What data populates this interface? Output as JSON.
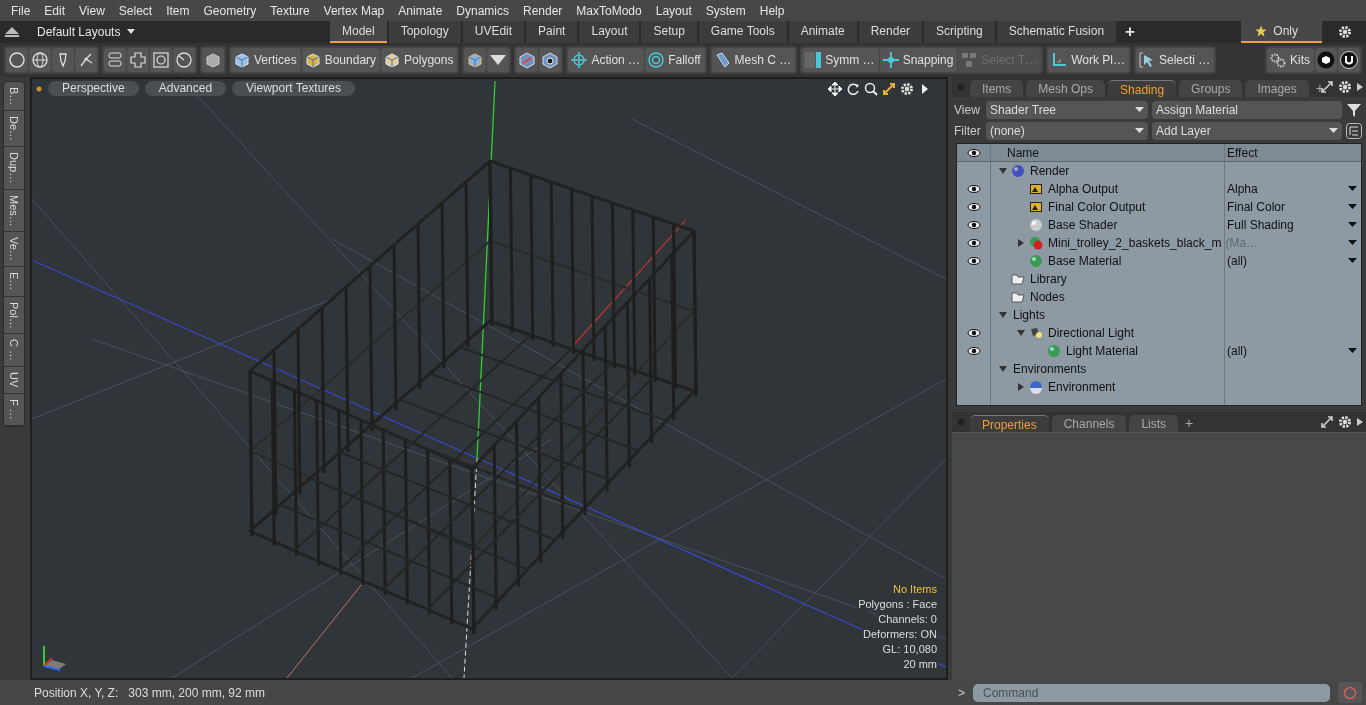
{
  "menu": [
    "File",
    "Edit",
    "View",
    "Select",
    "Item",
    "Geometry",
    "Texture",
    "Vertex Map",
    "Animate",
    "Dynamics",
    "Render",
    "MaxToModo",
    "Layout",
    "System",
    "Help"
  ],
  "layout_bar": {
    "layouts": "Default Layouts",
    "tabs": [
      {
        "label": "Model",
        "selected": true
      },
      {
        "label": "Topology",
        "selected": false
      },
      {
        "label": "UVEdit",
        "selected": false
      },
      {
        "label": "Paint",
        "selected": false
      },
      {
        "label": "Layout",
        "selected": false
      },
      {
        "label": "Setup",
        "selected": false
      },
      {
        "label": "Game Tools",
        "selected": false
      },
      {
        "label": "Animate",
        "selected": false
      },
      {
        "label": "Render",
        "selected": false
      },
      {
        "label": "Scripting",
        "selected": false
      },
      {
        "label": "Schematic Fusion",
        "selected": false
      }
    ],
    "add_tab": "+",
    "only": {
      "label": "Only",
      "selected": true
    }
  },
  "toolbar": [
    [
      {
        "kind": "icon"
      },
      {
        "kind": "icon"
      },
      {
        "kind": "icon"
      },
      {
        "kind": "icon"
      }
    ],
    [
      {
        "kind": "icon"
      },
      {
        "kind": "icon"
      },
      {
        "kind": "icon"
      },
      {
        "kind": "icon"
      }
    ],
    [
      {
        "kind": "icon"
      }
    ],
    [
      {
        "kind": "label",
        "label": "Vertices",
        "disabled": false
      },
      {
        "kind": "label",
        "label": "Boundary",
        "disabled": false
      },
      {
        "kind": "label",
        "label": "Polygons",
        "disabled": false
      }
    ],
    [
      {
        "kind": "icon"
      },
      {
        "kind": "icon"
      }
    ],
    [
      {
        "kind": "icon"
      },
      {
        "kind": "icon"
      }
    ],
    [
      {
        "kind": "label",
        "label": "Action …",
        "disabled": false
      },
      {
        "kind": "label",
        "label": "Falloff",
        "disabled": false
      }
    ],
    [
      {
        "kind": "label",
        "label": "Mesh C …",
        "disabled": false
      }
    ],
    [
      {
        "kind": "label",
        "label": "Symm …",
        "disabled": false
      },
      {
        "kind": "label",
        "label": "Snapping",
        "disabled": false
      },
      {
        "kind": "label",
        "label": "Select T…",
        "disabled": true
      }
    ],
    [
      {
        "kind": "label",
        "label": "Work Pl…",
        "disabled": false
      }
    ],
    [
      {
        "kind": "label",
        "label": "Selecti …",
        "disabled": false
      }
    ],
    [
      {
        "kind": "label",
        "label": "Kits",
        "disabled": false
      },
      {
        "kind": "icon"
      },
      {
        "kind": "icon"
      }
    ]
  ],
  "side_tabs": [
    "B…",
    "De…",
    "Dup…",
    "Mes…",
    "Ve…",
    "E…",
    "Pol…",
    "C …",
    "UV",
    "F …"
  ],
  "viewport": {
    "buttons": [
      "Perspective",
      "Advanced",
      "Viewport Textures"
    ],
    "info": [
      {
        "text": "No Items",
        "kind": "highlight"
      },
      {
        "text": "Polygons : Face",
        "kind": "plain"
      },
      {
        "text": "Channels: 0",
        "kind": "plain"
      },
      {
        "text": "Deformers: ON",
        "kind": "plain"
      },
      {
        "text": "GL: 10,080",
        "kind": "plain"
      },
      {
        "text": "20 mm",
        "kind": "plain"
      }
    ]
  },
  "status_bar": {
    "label": "Position X, Y, Z:",
    "value": "303 mm, 200 mm, 92 mm"
  },
  "shading_panel": {
    "tabs": [
      {
        "label": "Items",
        "selected": false
      },
      {
        "label": "Mesh Ops",
        "selected": false
      },
      {
        "label": "Shading",
        "selected": true
      },
      {
        "label": "Groups",
        "selected": false
      },
      {
        "label": "Images",
        "selected": false
      }
    ],
    "add_tab": "+",
    "view_label": "View",
    "view_value": "Shader Tree",
    "assign": "Assign Material",
    "filter_label": "Filter",
    "filter_value": "(none)",
    "add_layer": "Add Layer",
    "columns": [
      "Name",
      "Effect"
    ],
    "tree": [
      {
        "name": "Render",
        "kind": "render",
        "visible": false,
        "expanded": true,
        "children": [
          {
            "name": "Alpha Output",
            "kind": "output",
            "visible": true,
            "effect": "Alpha",
            "dropdown": true
          },
          {
            "name": "Final Color Output",
            "kind": "output",
            "visible": true,
            "effect": "Final Color",
            "dropdown": true
          },
          {
            "name": "Base Shader",
            "kind": "shader",
            "visible": true,
            "effect": "Full Shading",
            "dropdown": true
          },
          {
            "name": "Mini_trolley_2_baskets_black_m",
            "suffix": "(Ma…",
            "kind": "mask",
            "visible": true,
            "expanded": false,
            "dropdown": true
          },
          {
            "name": "Base Material",
            "kind": "material",
            "visible": true,
            "effect": "(all)",
            "dropdown": true
          }
        ]
      },
      {
        "name": "Library",
        "kind": "folder",
        "visible": false
      },
      {
        "name": "Nodes",
        "kind": "folder",
        "visible": false
      },
      {
        "name": "Lights",
        "kind": "group",
        "visible": false,
        "expanded": true,
        "children": [
          {
            "name": "Directional Light",
            "kind": "light",
            "visible": true,
            "expanded": true,
            "children": [
              {
                "name": "Light Material",
                "kind": "material",
                "visible": true,
                "effect": "(all)",
                "dropdown": true
              }
            ]
          }
        ]
      },
      {
        "name": "Environments",
        "kind": "group",
        "visible": false,
        "expanded": true,
        "children": [
          {
            "name": "Environment",
            "kind": "environment",
            "visible": false,
            "expanded": false
          }
        ]
      }
    ]
  },
  "properties_panel": {
    "tabs": [
      {
        "label": "Properties",
        "selected": true
      },
      {
        "label": "Channels",
        "selected": false
      },
      {
        "label": "Lists",
        "selected": false
      }
    ],
    "add_tab": "+"
  },
  "command": {
    "prompt": ">",
    "placeholder": "Command"
  }
}
